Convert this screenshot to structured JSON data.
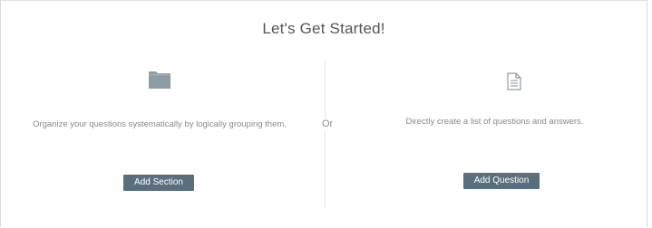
{
  "header": {
    "title": "Let's Get Started!"
  },
  "separator": {
    "label": "Or"
  },
  "sections_option": {
    "icon": "folder-icon",
    "description": "Organize your questions systematically by logically grouping them.",
    "button_label": "Add Section"
  },
  "questions_option": {
    "icon": "document-icon",
    "description": "Directly create a list of questions and answers.",
    "button_label": "Add Question"
  },
  "colors": {
    "button_bg": "#5a6f7e",
    "icon": "#8e9ca3",
    "text_muted": "#8a8a8a",
    "title": "#555555"
  }
}
